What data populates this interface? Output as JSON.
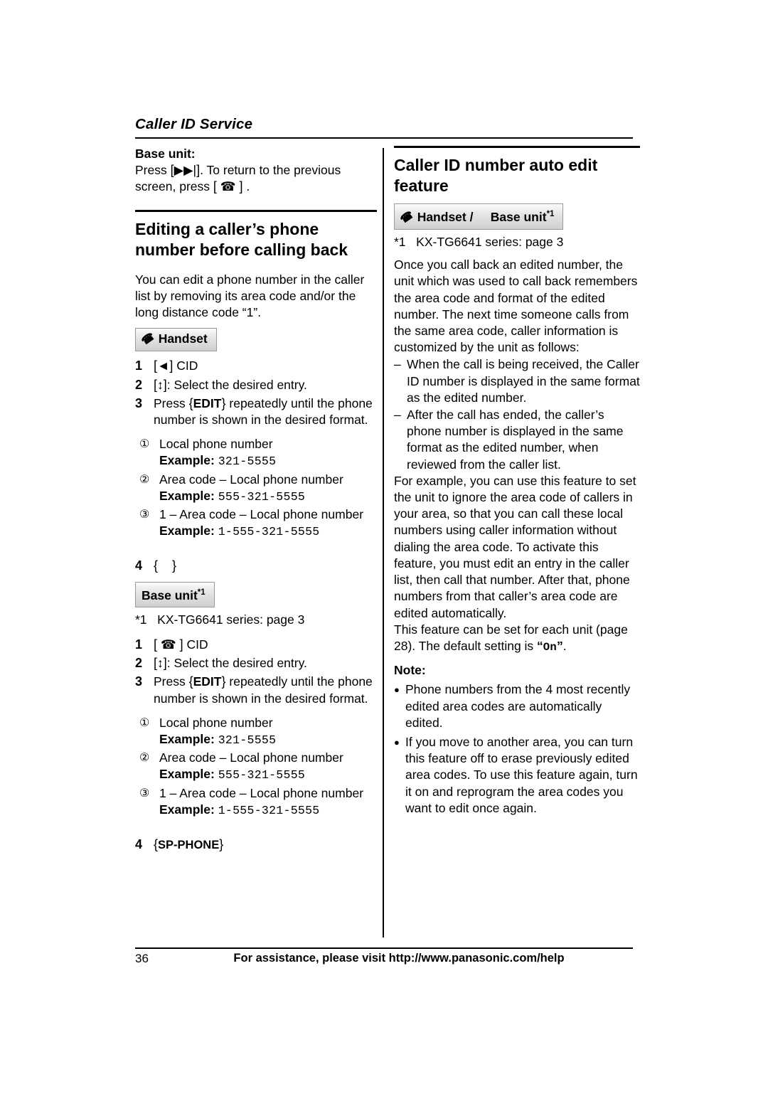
{
  "header": {
    "section_title": "Caller ID Service"
  },
  "footer": {
    "page_number": "36",
    "text": "For assistance, please visit http://www.panasonic.com/help"
  },
  "left_column": {
    "base_unit_head": "Base unit:",
    "base_unit_text_1": "Press ",
    "base_unit_key": "[",
    "base_unit_text_2": ". To return to the previous screen, press ",
    "base_unit_text_3": " .",
    "section_title": "Editing a caller’s phone number before calling back",
    "intro": "You can edit a phone number in the caller list by removing its area code and/or the long distance code “1”.",
    "handset_banner": "Handset",
    "handset_steps": [
      {
        "num": "1",
        "text": "CID",
        "key": "◄"
      },
      {
        "num": "2",
        "text": ": Select the desired entry.",
        "key": "↕"
      },
      {
        "num": "3",
        "text": "Press {EDIT} repeatedly until the phone number is shown in the desired format."
      }
    ],
    "formats": [
      {
        "circle": "①",
        "label": "Local phone number",
        "example_label": "Example:",
        "example": "321-5555"
      },
      {
        "circle": "②",
        "label": "Area code – Local phone number",
        "example_label": "Example:",
        "example": "555-321-5555"
      },
      {
        "circle": "③",
        "label": "1 – Area code – Local phone number",
        "example_label": "Example:",
        "example": "1-555-321-5555"
      }
    ],
    "handset_step4": {
      "num": "4",
      "text": "{    }"
    },
    "base_banner": "Base unit",
    "base_banner_sup": "*1",
    "footnote_mark": "*1",
    "footnote_text": "KX-TG6641 series: page 3",
    "base_steps": [
      {
        "num": "1",
        "text": "CID"
      },
      {
        "num": "2",
        "text": ": Select the desired entry.",
        "key": "↕"
      },
      {
        "num": "3",
        "text": "Press {EDIT} repeatedly until the phone number is shown in the desired format."
      }
    ],
    "base_step4": {
      "num": "4",
      "text": "{SP-PHONE}"
    }
  },
  "right_column": {
    "section_title": "Caller ID number auto edit feature",
    "banner_handset": "Handset /",
    "banner_base": "Base unit",
    "banner_base_sup": "*1",
    "footnote_mark": "*1",
    "footnote_text": "KX-TG6641 series: page 3",
    "para1": "Once you call back an edited number, the unit which was used to call back remembers the area code and format of the edited number. The next time someone calls from the same area code, caller information is customized by the unit as follows:",
    "dash_items": [
      "When the call is being received, the Caller ID number is displayed in the same format as the edited number.",
      "After the call has ended, the caller’s phone number is displayed in the same format as the edited number, when reviewed from the caller list."
    ],
    "para2": "For example, you can use this feature to set the unit to ignore the area code of callers in your area, so that you can call these local numbers using caller information without dialing the area code. To activate this feature, you must edit an entry in the caller list, then call that number. After that, phone numbers from that caller’s area code are edited automatically.",
    "para3_a": "This feature can be set for each unit (page 28). The default setting is ",
    "para3_on": "“On”",
    "para3_b": ".",
    "note_head": "Note:",
    "notes": [
      "Phone numbers from the 4 most recently edited area codes are automatically edited.",
      "If you move to another area, you can turn this feature off to erase previously edited area codes. To use this feature again, turn it on and reprogram the area codes you want to edit once again."
    ]
  }
}
